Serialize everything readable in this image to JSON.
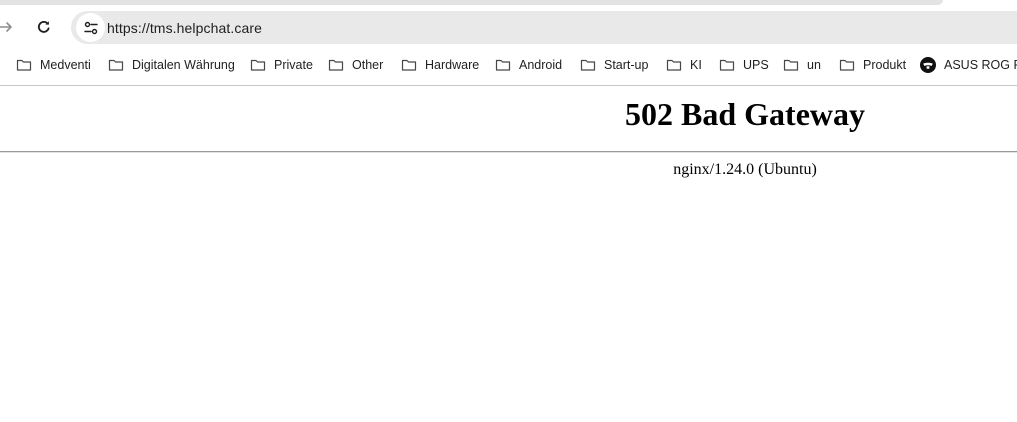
{
  "browser": {
    "url": "https://tms.helpchat.care",
    "icons": {
      "forward": "arrow-right-icon",
      "reload": "reload-icon",
      "site_info": "tune-icon"
    }
  },
  "bookmarks": [
    {
      "label": "Medventi",
      "icon": "folder-icon"
    },
    {
      "label": "Digitalen Währung",
      "icon": "folder-icon"
    },
    {
      "label": "Private",
      "icon": "folder-icon"
    },
    {
      "label": "Other",
      "icon": "folder-icon"
    },
    {
      "label": "Hardware",
      "icon": "folder-icon"
    },
    {
      "label": "Android",
      "icon": "folder-icon"
    },
    {
      "label": "Start-up",
      "icon": "folder-icon"
    },
    {
      "label": "KI",
      "icon": "folder-icon"
    },
    {
      "label": "UPS",
      "icon": "folder-icon"
    },
    {
      "label": "un",
      "icon": "folder-icon"
    },
    {
      "label": "Produkt",
      "icon": "folder-icon"
    },
    {
      "label": "ASUS ROG Flo",
      "icon": "asus-rog-icon"
    }
  ],
  "page": {
    "title": "502 Bad Gateway",
    "server": "nginx/1.24.0 (Ubuntu)"
  },
  "colors": {
    "omnibox_bg": "#e9e9e9",
    "text": "#1f1f1f",
    "rule": "#9a9a9a"
  }
}
